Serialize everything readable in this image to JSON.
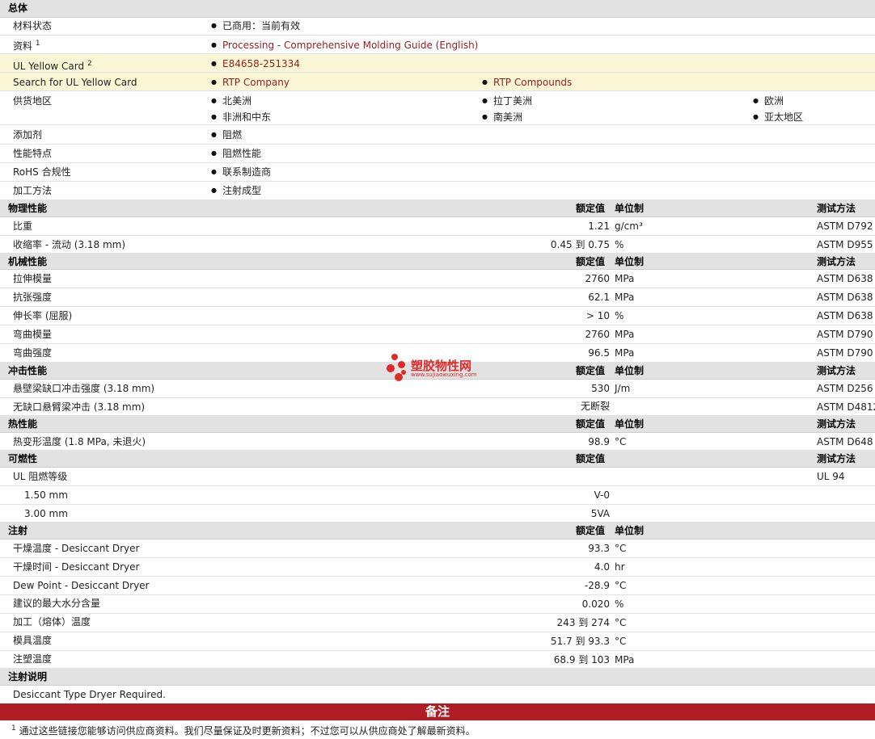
{
  "general": {
    "section": "总体",
    "rows": [
      {
        "label": "材料状态",
        "values": [
          "已商用：当前有效"
        ]
      },
      {
        "label": "资料",
        "sup": "1",
        "values": [
          "Processing - Comprehensive Molding Guide (English)"
        ]
      },
      {
        "label": "UL Yellow Card",
        "sup": "2",
        "values": [
          "E84658-251334"
        ]
      },
      {
        "label": "Search for UL Yellow Card",
        "values": [
          "RTP Company",
          "RTP Compounds"
        ]
      },
      {
        "label": "供货地区",
        "values": [
          "北美洲",
          "拉丁美洲",
          "欧洲",
          "非洲和中东",
          "南美洲",
          "亚太地区"
        ]
      },
      {
        "label": "添加剂",
        "values": [
          "阻燃"
        ]
      },
      {
        "label": "性能特点",
        "values": [
          "阻燃性能"
        ]
      },
      {
        "label": "RoHS 合规性",
        "values": [
          "联系制造商"
        ]
      },
      {
        "label": "加工方法",
        "values": [
          "注射成型"
        ]
      }
    ]
  },
  "headers": {
    "rated": "额定值",
    "unit": "单位制",
    "method": "测试方法"
  },
  "physical": {
    "section": "物理性能",
    "rows": [
      {
        "label": "比重",
        "value": "1.21",
        "unit": "g/cm³",
        "method": "ASTM D792"
      },
      {
        "label": "收缩率  - 流动  (3.18 mm)",
        "value": "0.45 到  0.75",
        "unit": "%",
        "method": "ASTM D955"
      }
    ]
  },
  "mechanical": {
    "section": "机械性能",
    "rows": [
      {
        "label": "拉伸模量",
        "value": "2760",
        "unit": "MPa",
        "method": "ASTM D638"
      },
      {
        "label": "抗张强度",
        "value": "62.1",
        "unit": "MPa",
        "method": "ASTM D638"
      },
      {
        "label": "伸长率  (屈服)",
        "value": "> 10",
        "unit": "%",
        "method": "ASTM D638"
      },
      {
        "label": "弯曲模量",
        "value": "2760",
        "unit": "MPa",
        "method": "ASTM D790"
      },
      {
        "label": "弯曲强度",
        "value": "96.5",
        "unit": "MPa",
        "method": "ASTM D790"
      }
    ]
  },
  "impact": {
    "section": "冲击性能",
    "rows": [
      {
        "label": "悬壁梁缺口冲击强度  (3.18 mm)",
        "value": "530",
        "unit": "J/m",
        "method": "ASTM D256"
      },
      {
        "label": "无缺口悬臂梁冲击  (3.18 mm)",
        "value": "无断裂",
        "unit": "",
        "method": "ASTM D4812"
      }
    ]
  },
  "thermal": {
    "section": "热性能",
    "rows": [
      {
        "label": "热变形温度  (1.8 MPa, 未退火)",
        "value": "98.9",
        "unit": "°C",
        "method": "ASTM D648"
      }
    ]
  },
  "flammability": {
    "section": "可燃性",
    "rows": [
      {
        "label": "UL 阻燃等级",
        "value": "",
        "unit": "",
        "method": "UL 94"
      },
      {
        "label": "1.50 mm",
        "value": "V-0",
        "unit": "",
        "method": ""
      },
      {
        "label": "3.00 mm",
        "value": "5VA",
        "unit": "",
        "method": ""
      }
    ]
  },
  "injection": {
    "section": "注射",
    "rows": [
      {
        "label": "干燥温度  - Desiccant Dryer",
        "value": "93.3",
        "unit": "°C"
      },
      {
        "label": "干燥时间  - Desiccant Dryer",
        "value": "4.0",
        "unit": "hr"
      },
      {
        "label": "Dew Point - Desiccant Dryer",
        "value": "-28.9",
        "unit": "°C"
      },
      {
        "label": "建议的最大水分含量",
        "value": "0.020",
        "unit": "%"
      },
      {
        "label": "加工（熔体）温度",
        "value": "243 到  274",
        "unit": "°C"
      },
      {
        "label": "模具温度",
        "value": "51.7 到  93.3",
        "unit": "°C"
      },
      {
        "label": "注塑温度",
        "value": "68.9 到  103",
        "unit": "MPa"
      }
    ]
  },
  "injection_notes": {
    "section": "注射说明",
    "text": "Desiccant Type Dryer Required."
  },
  "notes": {
    "title": "备注",
    "footnote_num": "1",
    "footnote": "通过这些链接您能够访问供应商资料。我们尽量保证及时更新资料；不过您可以从供应商处了解最新资料。"
  },
  "watermark": {
    "name": "塑胶物性网",
    "url": "www.sujiaowuxing.com"
  },
  "colors": {
    "link": "#9b1b1e",
    "section_bg": "#e2e2e2",
    "highlight_bg": "#fbf7d6",
    "notes_bar": "#b11d25"
  }
}
